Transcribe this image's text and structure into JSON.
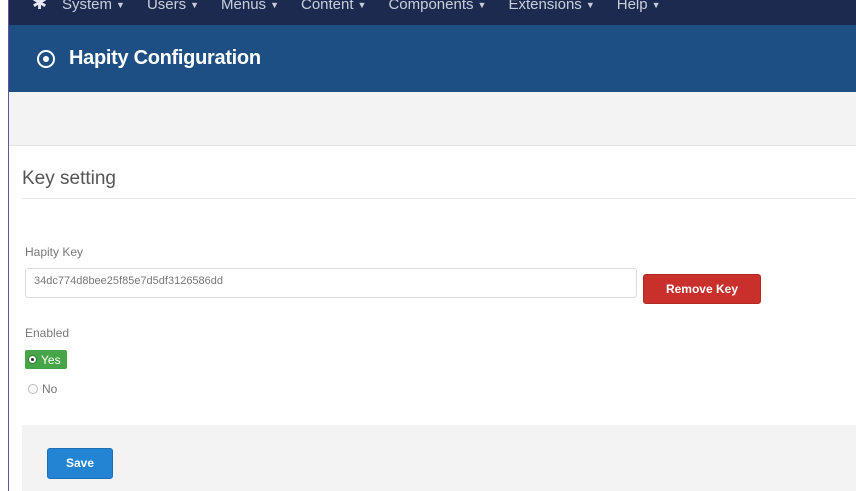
{
  "topnav": {
    "items": [
      {
        "label": "System"
      },
      {
        "label": "Users"
      },
      {
        "label": "Menus"
      },
      {
        "label": "Content"
      },
      {
        "label": "Components"
      },
      {
        "label": "Extensions"
      },
      {
        "label": "Help"
      }
    ]
  },
  "header": {
    "title": "Hapity Configuration",
    "icon": "target-icon"
  },
  "form": {
    "legend": "Key setting",
    "key_label": "Hapity Key",
    "key_value": "34dc774d8bee25f85e7d5df3126586dd",
    "remove_label": "Remove Key",
    "enabled_label": "Enabled",
    "options": [
      {
        "label": "Yes",
        "selected": true
      },
      {
        "label": "No",
        "selected": false
      }
    ],
    "save_label": "Save"
  },
  "colors": {
    "topnav_bg": "#1b2a4e",
    "header_bg": "#1e4f84",
    "danger": "#c9302c",
    "success": "#46a546",
    "primary": "#2384d3"
  }
}
